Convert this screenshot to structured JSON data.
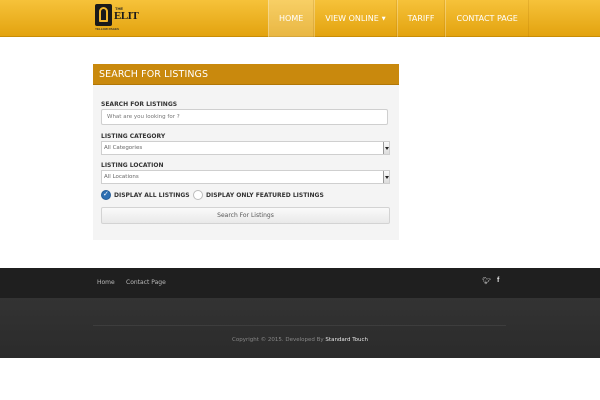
{
  "brand": {
    "the": "THE",
    "name": "ELIT",
    "sub": "YELLOW PAGES"
  },
  "nav": {
    "items": [
      {
        "label": "HOME"
      },
      {
        "label": "VIEW ONLINE"
      },
      {
        "label": "TARIFF"
      },
      {
        "label": "CONTACT PAGE"
      }
    ]
  },
  "search": {
    "panel_title": "SEARCH FOR LISTINGS",
    "keyword_label": "SEARCH FOR LISTINGS",
    "keyword_placeholder": "What are you looking for ?",
    "category_label": "LISTING CATEGORY",
    "category_value": "All Categories",
    "location_label": "LISTING LOCATION",
    "location_value": "All Locations",
    "radio_all": "DISPLAY ALL LISTINGS",
    "radio_featured": "DISPLAY ONLY FEATURED LISTINGS",
    "submit_label": "Search For Listings"
  },
  "footer": {
    "links": [
      {
        "label": "Home"
      },
      {
        "label": "Contact Page"
      }
    ],
    "social": [
      "twitter-icon",
      "facebook-icon"
    ],
    "copyright_prefix": "Copyright © 2015. Developed By",
    "developer": "Standard Touch"
  },
  "colors": {
    "accent": "#f2b62a",
    "panel_header": "#c9890d",
    "radio_active": "#2d6fb3"
  }
}
